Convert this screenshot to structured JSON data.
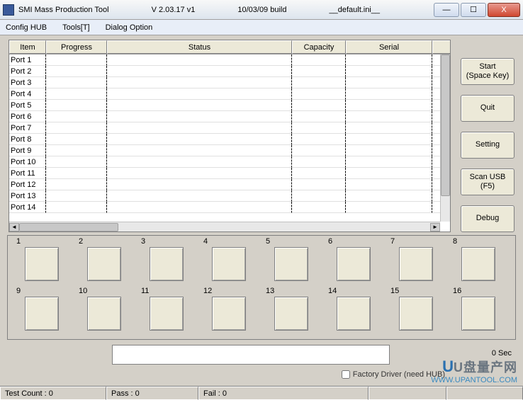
{
  "window": {
    "title": "SMI Mass Production Tool",
    "version": "V 2.03.17   v1",
    "build": "10/03/09 build",
    "config": "__default.ini__"
  },
  "menu": {
    "config_hub": "Config HUB",
    "tools": "Tools[T]",
    "dialog_option": "Dialog Option"
  },
  "table": {
    "headers": {
      "item": "Item",
      "progress": "Progress",
      "status": "Status",
      "capacity": "Capacity",
      "serial": "Serial"
    },
    "rows": [
      {
        "item": "Port 1",
        "progress": "",
        "status": "",
        "capacity": "",
        "serial": ""
      },
      {
        "item": "Port 2",
        "progress": "",
        "status": "",
        "capacity": "",
        "serial": ""
      },
      {
        "item": "Port 3",
        "progress": "",
        "status": "",
        "capacity": "",
        "serial": ""
      },
      {
        "item": "Port 4",
        "progress": "",
        "status": "",
        "capacity": "",
        "serial": ""
      },
      {
        "item": "Port 5",
        "progress": "",
        "status": "",
        "capacity": "",
        "serial": ""
      },
      {
        "item": "Port 6",
        "progress": "",
        "status": "",
        "capacity": "",
        "serial": ""
      },
      {
        "item": "Port 7",
        "progress": "",
        "status": "",
        "capacity": "",
        "serial": ""
      },
      {
        "item": "Port 8",
        "progress": "",
        "status": "",
        "capacity": "",
        "serial": ""
      },
      {
        "item": "Port 9",
        "progress": "",
        "status": "",
        "capacity": "",
        "serial": ""
      },
      {
        "item": "Port 10",
        "progress": "",
        "status": "",
        "capacity": "",
        "serial": ""
      },
      {
        "item": "Port 11",
        "progress": "",
        "status": "",
        "capacity": "",
        "serial": ""
      },
      {
        "item": "Port 12",
        "progress": "",
        "status": "",
        "capacity": "",
        "serial": ""
      },
      {
        "item": "Port 13",
        "progress": "",
        "status": "",
        "capacity": "",
        "serial": ""
      },
      {
        "item": "Port 14",
        "progress": "",
        "status": "",
        "capacity": "",
        "serial": ""
      }
    ]
  },
  "buttons": {
    "start_l1": "Start",
    "start_l2": "(Space Key)",
    "quit": "Quit",
    "setting": "Setting",
    "scan_l1": "Scan USB",
    "scan_l2": "(F5)",
    "debug": "Debug"
  },
  "slots": [
    1,
    2,
    3,
    4,
    5,
    6,
    7,
    8,
    9,
    10,
    11,
    12,
    13,
    14,
    15,
    16
  ],
  "bottom": {
    "sec": "0 Sec",
    "checkbox_label": "Factory Driver (need HUB)"
  },
  "status": {
    "test_count": "Test Count : 0",
    "pass": "Pass : 0",
    "fail": "Fail : 0"
  },
  "watermark": {
    "cn": "U盘量产网",
    "url": "WWW.UPANTOOL.COM"
  },
  "winbtns": {
    "min": "—",
    "max": "☐",
    "close": "X"
  }
}
